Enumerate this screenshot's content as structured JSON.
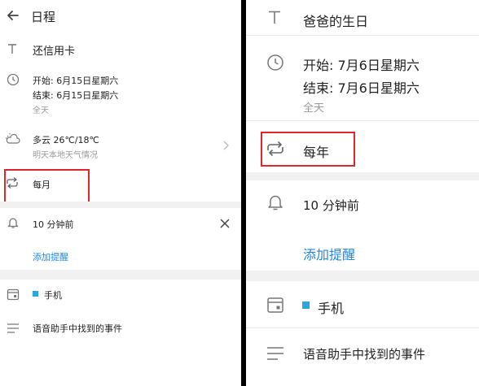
{
  "left": {
    "header": {
      "title": "日程"
    },
    "event_title": "还信用卡",
    "time": {
      "start": "开始:  6月15日星期六",
      "end": "结束:  6月15日星期六",
      "all_day": "全天"
    },
    "weather": {
      "summary": "多云 26℃/18℃",
      "detail": "明天本地天气情况"
    },
    "repeat": {
      "label": "每月"
    },
    "reminder": {
      "label": "10 分钟前",
      "add_label": "添加提醒"
    },
    "calendar": {
      "label": "手机",
      "color": "#29a8e0"
    },
    "source": {
      "label": "语音助手中找到的事件"
    }
  },
  "right": {
    "event_title": "爸爸的生日",
    "time": {
      "start": "开始:  7月6日星期六",
      "end": "结束:  7月6日星期六",
      "all_day": "全天"
    },
    "repeat": {
      "label": "每年"
    },
    "reminder": {
      "label": "10 分钟前",
      "add_label": "添加提醒"
    },
    "calendar": {
      "label": "手机",
      "color": "#29a8e0"
    },
    "source": {
      "label": "语音助手中找到的事件"
    }
  },
  "colors": {
    "highlight": "#e0262d",
    "link": "#1e88e5"
  },
  "icons": [
    "back-arrow-icon",
    "title-icon",
    "clock-icon",
    "weather-icon",
    "chevron-right-icon",
    "repeat-icon",
    "bell-icon",
    "close-icon",
    "calendar-icon",
    "notes-icon"
  ]
}
